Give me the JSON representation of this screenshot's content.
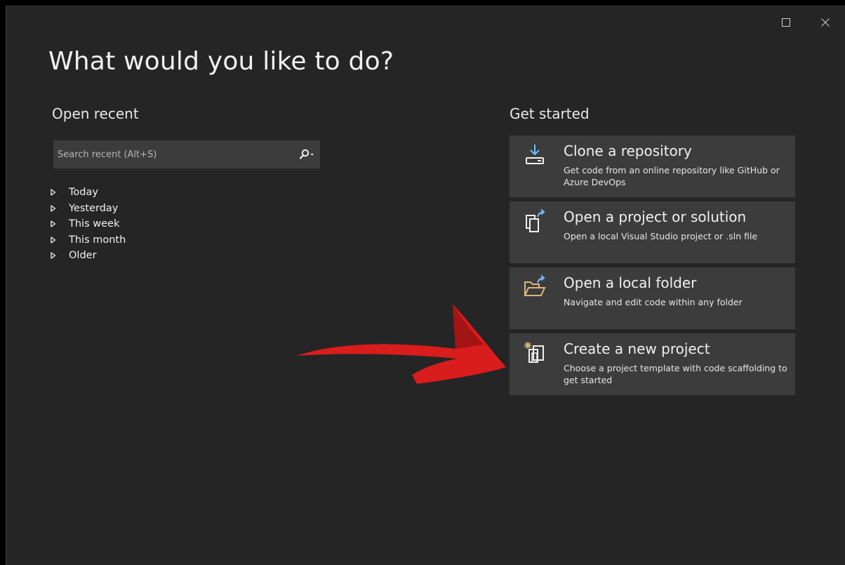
{
  "window": {
    "maximize_icon": "maximize-icon",
    "close_icon": "close-icon"
  },
  "heading": "What would you like to do?",
  "open_recent": {
    "title": "Open recent",
    "search_placeholder": "Search recent (Alt+S)",
    "search_icon": "search-icon",
    "groups": [
      {
        "label": "Today"
      },
      {
        "label": "Yesterday"
      },
      {
        "label": "This week"
      },
      {
        "label": "This month"
      },
      {
        "label": "Older"
      }
    ]
  },
  "get_started": {
    "title": "Get started",
    "cards": [
      {
        "title": "Clone a repository",
        "description": "Get code from an online repository like GitHub or Azure DevOps",
        "icon": "clone-download-icon"
      },
      {
        "title": "Open a project or solution",
        "description": "Open a local Visual Studio project or .sln file",
        "icon": "open-project-icon"
      },
      {
        "title": "Open a local folder",
        "description": "Navigate and edit code within any folder",
        "icon": "open-folder-icon"
      },
      {
        "title": "Create a new project",
        "description": "Choose a project template with code scaffolding to get started",
        "icon": "new-project-icon"
      }
    ]
  },
  "colors": {
    "background": "#252526",
    "card": "#3c3c3c",
    "accent_blue": "#75beff",
    "folder_yellow": "#dcb67a",
    "annotation_red": "#d91c1c"
  }
}
